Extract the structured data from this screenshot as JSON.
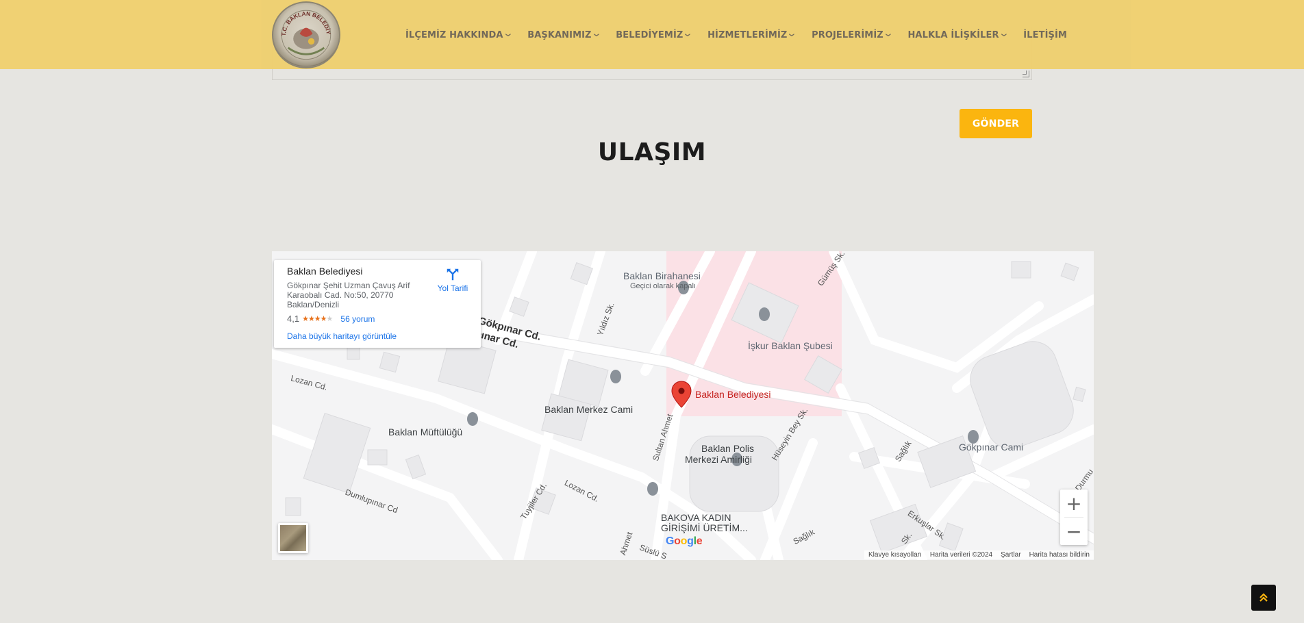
{
  "header": {
    "logo_text": "T.C. BAKLAN BELEDİYESİ",
    "nav": [
      {
        "label": "İLÇEMİZ HAKKINDA",
        "has_dropdown": true
      },
      {
        "label": "BAŞKANIMIZ",
        "has_dropdown": true
      },
      {
        "label": "BELEDİYEMİZ",
        "has_dropdown": true
      },
      {
        "label": "HİZMETLERİMİZ",
        "has_dropdown": true
      },
      {
        "label": "PROJELERİMİZ",
        "has_dropdown": true
      },
      {
        "label": "HALKLA İLİŞKİLER",
        "has_dropdown": true
      },
      {
        "label": "İLETİŞİM",
        "has_dropdown": false
      }
    ],
    "background_color": "#efd070"
  },
  "form": {
    "submit_label": "GÖNDER",
    "accent_color": "#fbb50f"
  },
  "section": {
    "title": "ULAŞIM"
  },
  "map": {
    "info_card": {
      "name": "Baklan Belediyesi",
      "address": "Gökpınar Şehit Uzman Çavuş Arif Karaobalı Cad. No:50, 20770 Baklan/Denizli",
      "rating": "4,1",
      "stars_filled": 4,
      "reviews": "56 yorum",
      "directions": "Yol Tarifi",
      "bigger_map": "Daha büyük haritayı görüntüle"
    },
    "pin_label": "Baklan Belediyesi",
    "places": {
      "birahane": "Baklan Birahanesi",
      "birahane_status": "Geçici olarak kapalı",
      "iskur": "İşkur Baklan Şubesi",
      "merkez_cami": "Baklan Merkez Cami",
      "muftuluk": "Baklan Müftülüğü",
      "polis_1": "Baklan Polis",
      "polis_2": "Merkezi Amirliği",
      "gokpinar_cami": "Gökpınar Cami",
      "bakova_1": "BAKOVA KADIN",
      "bakova_2": "GİRİŞİMİ ÜRETİM..."
    },
    "roads": {
      "gokpinar_1": "Gökpınar Cd.",
      "gokpinar_2": "pınar Cd.",
      "yildiz": "Yıldız Sk.",
      "gumus": "Gümüş Sk.",
      "lozan_1": "Lozan Cd.",
      "lozan_2": "Lozan Cd.",
      "sultan_ahmet": "Sultan Ahmet",
      "huseyin_bey": "Hüseyin Bey Sk.",
      "saglik_1": "Sağlık",
      "saglik_2": "Sağlık",
      "dumlupinar": "Dumlupınar Cd",
      "tuyjiler": "Tuyjiler Cd.",
      "erkuslar": "Erkuşlar Sk.",
      "ahmet": "Ahmet",
      "suslu": "Süslü S",
      "sk": "Sk.",
      "durmus": "Durmu"
    },
    "zoom_in": "+",
    "zoom_out": "−",
    "google": [
      "G",
      "o",
      "o",
      "g",
      "l",
      "e"
    ],
    "google_colors": [
      "#4285f4",
      "#ea4335",
      "#fbbc05",
      "#4285f4",
      "#34a853",
      "#ea4335"
    ],
    "attribution": [
      "Klavye kısayolları",
      "Harita verileri ©2024",
      "Şartlar",
      "Harita hatası bildirin"
    ]
  },
  "scroll_top_icon": "double-chevron-up-icon"
}
